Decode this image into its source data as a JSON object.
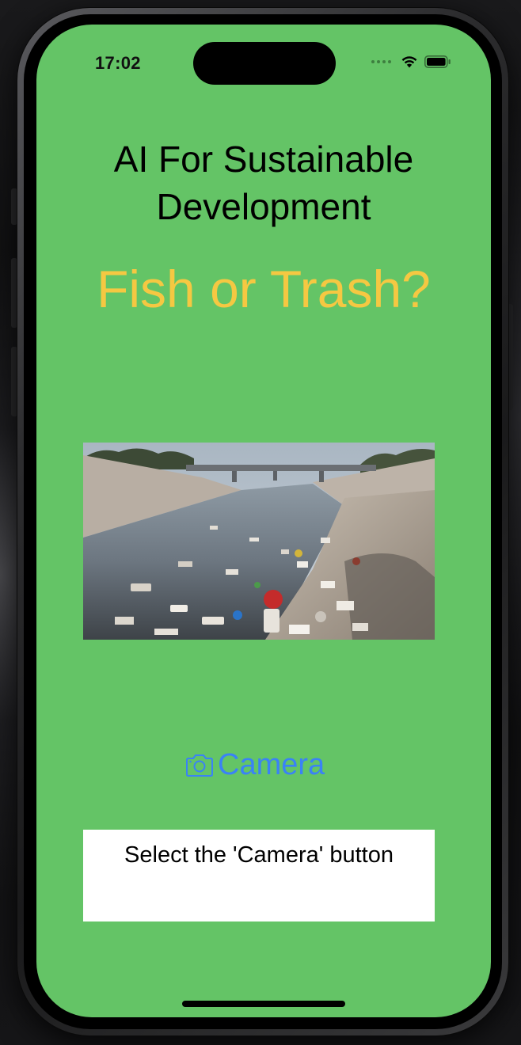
{
  "status_bar": {
    "time": "17:02"
  },
  "app": {
    "title": "AI For Sustainable Development",
    "subtitle": "Fish or Trash?",
    "camera_button": {
      "label": "Camera",
      "icon": "camera-icon"
    },
    "result_text": "Select the 'Camera' button"
  },
  "colors": {
    "background": "#64c466",
    "subtitle": "#f5c842",
    "button": "#3a82f6"
  }
}
